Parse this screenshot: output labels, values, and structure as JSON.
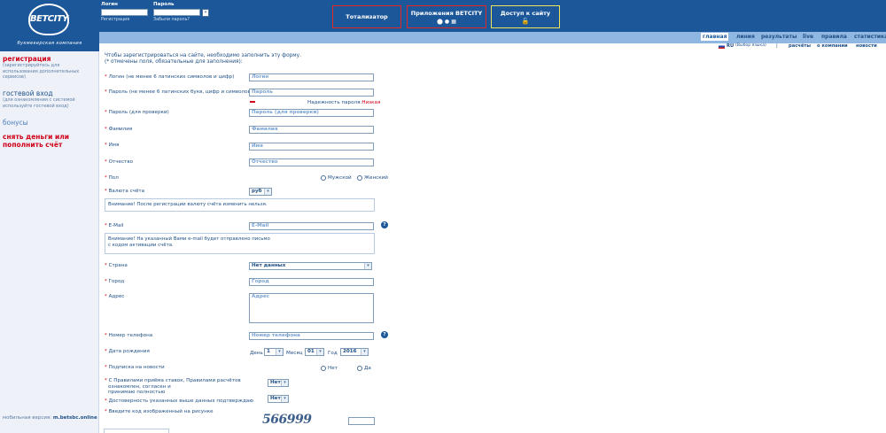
{
  "header": {
    "logo_text": "BETCITY",
    "logo_subtitle": "букмекерская компания",
    "login_label": "Логин",
    "password_label": "Пароль",
    "register_link": "Регистрация",
    "forgot_link": "Забыли пароль?",
    "go_label": "»",
    "totalizator_label": "Тотализатор",
    "apps_label": "Приложения BETCITY",
    "apps_icons": "⬤ ● ▦",
    "access_label": "Доступ к сайту",
    "access_icon": "🔓"
  },
  "nav": {
    "items": [
      "главная",
      "линия",
      "результаты",
      "live",
      "правила",
      "статистика"
    ]
  },
  "subnav": {
    "lang": "RU",
    "lang_choose": "(Выбор языка)",
    "sep": "|",
    "items": [
      "расчёты",
      "о компании",
      "новости"
    ]
  },
  "sidebar": {
    "register": "регистрация",
    "register_note": "(зарегистрируйтесь для использования дополнительных сервисов)",
    "guest": "гостевой вход",
    "guest_note": "(для ознакомления с системой используйте гостевой вход)",
    "bonus": "бонусы",
    "withdraw": "снять деньги или пополнить счёт",
    "mobile_label": "мобильная версия:",
    "mobile_url": "m.betsbc.online"
  },
  "form": {
    "intro1": "Чтобы зарегистрироваться на сайте, необходимо заполнить эту форму.",
    "intro2": "(* отмечены поля, обязательные для заполнения):",
    "login_label": "Логин (не менее 6 латинских символов и цифр)",
    "login_ph": "Логин",
    "pass_label": "Пароль (не менее 6 латинских букв, цифр и символов)",
    "pass_ph": "Пароль",
    "strength_label": "Надежность пароля:",
    "strength_value": "Низкая",
    "pass2_label": "Пароль (для проверки)",
    "pass2_ph": "Пароль (для проверки)",
    "surname_label": "Фамилия",
    "surname_ph": "Фамилия",
    "name_label": "Имя",
    "name_ph": "Имя",
    "patr_label": "Отчество",
    "patr_ph": "Отчество",
    "sex_label": "Пол",
    "male": "Мужской",
    "female": "Женский",
    "currency_label": "Валюта счёта",
    "currency_value": "руб",
    "currency_note": "Внимание! После регистрации валюту счёта изменить нельзя.",
    "email_label": "E-Mail",
    "email_ph": "E-Mail",
    "email_note1": "Внимание! На указанный Вами e-mail будет отправлено письмо",
    "email_note2": "с кодом активации счёта.",
    "country_label": "Страна",
    "country_value": "Нет данных",
    "city_label": "Город",
    "city_ph": "Город",
    "address_label": "Адрес",
    "address_ph": "Адрес",
    "phone_label": "Номер телефона",
    "phone_ph": "Номер телефона",
    "dob_label": "Дата рождения",
    "day_label": "День",
    "day_value": "1",
    "month_label": "Месяц",
    "month_value": "01",
    "year_label": "Год",
    "year_value": "2016",
    "news_label": "Подписка на новости",
    "no": "Нет",
    "yes": "Да",
    "rules_label1": "С Правилами приёма ставок, Правилами расчётов",
    "rules_label2": "ознакомлен, согласен и",
    "rules_label3": "принимаю полностью",
    "rules_value": "Нет",
    "confirm_label": "Достоверность указанных выше данных подтверждаю",
    "confirm_value": "Нет",
    "captcha_label": "Введите код изображенный на рисунке",
    "captcha_text": "566999",
    "help": "?"
  }
}
